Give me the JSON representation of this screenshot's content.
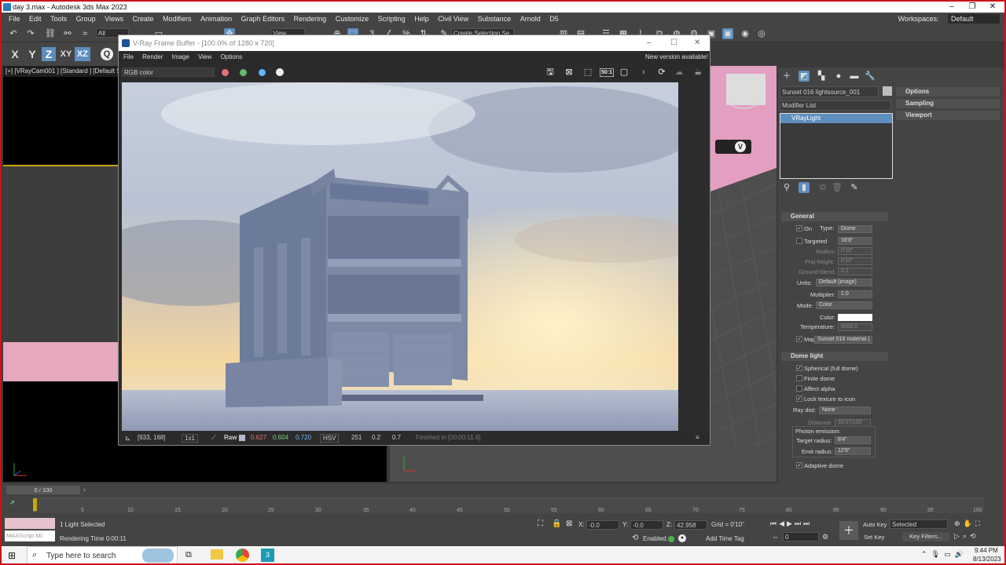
{
  "window": {
    "title": "day 3.max - Autodesk 3ds Max 2023"
  },
  "menu": [
    "File",
    "Edit",
    "Tools",
    "Group",
    "Views",
    "Create",
    "Modifiers",
    "Animation",
    "Graph Editors",
    "Rendering",
    "Customize",
    "Scripting",
    "Help",
    "Civil View",
    "Substance",
    "Arnold",
    "D5"
  ],
  "workspaces": {
    "label": "Workspaces:",
    "value": "Default"
  },
  "toolbar": {
    "filter": "All",
    "view": "View",
    "selection_set": "Create Selection Se"
  },
  "axes": {
    "x": "X",
    "y": "Y",
    "z": "Z",
    "xy": "XY",
    "xz": "XZ"
  },
  "viewport": {
    "label": "[+] [VRayCam001 ] [Standard ] [Default Sh"
  },
  "vfb": {
    "title": "V-Ray Frame Buffer - [100.0% of 1280 x 720]",
    "menu": [
      "File",
      "Render",
      "Image",
      "View",
      "Options"
    ],
    "new_version": "New version available!",
    "channel": "RGB color",
    "ratio": "50:1",
    "status": {
      "coords": "[933, 168]",
      "zoom": "1x1",
      "raw": "Raw",
      "r": "0.627",
      "g": "0.604",
      "b": "0.720",
      "mode": "HSV",
      "h": "251",
      "s": "0.2",
      "v": "0.7",
      "finished": "Finished in [00:00:11.6]"
    }
  },
  "command_panel": {
    "object_name": "Sunset 016 lightsource_001",
    "modifier_list": "Modifier List",
    "stack_item": "VRayLight",
    "rollouts_right": [
      "Options",
      "Sampling",
      "Viewport"
    ]
  },
  "general": {
    "title": "General",
    "on": "On",
    "type_label": "Type:",
    "type_value": "Dome",
    "targeted": "Targeted",
    "targeted_value": "16'8\"",
    "radius": "Radius:",
    "radius_value": "0'10\"",
    "proj_height": "Proj height:",
    "proj_value": "0'10\"",
    "ground_blend": "Ground blend:",
    "ground_value": "0.2",
    "units": "Units:",
    "units_value": "Default (image)",
    "multiplier": "Multiplier:",
    "multiplier_value": "1.0",
    "mode": "Mode:",
    "mode_value": "Color",
    "color": "Color:",
    "temperature": "Temperature:",
    "temperature_value": "6500.0",
    "map": "Map",
    "map_value": "Sunset 016 material  ("
  },
  "dome": {
    "title": "Dome light",
    "spherical": "Spherical (full dome)",
    "finite": "Finite dome",
    "affect_alpha": "Affect alpha",
    "lock": "Lock texture to icon",
    "ray_dist": "Ray dist:",
    "ray_value": "None",
    "distance": "Distance:",
    "distance_value": "33'37|100'",
    "photon": "Photon emission:",
    "target_radius": "Target radius:",
    "target_value": "8'4\"",
    "emit_radius": "Emit radius:",
    "emit_value": "12'6\"",
    "adaptive": "Adaptive dome"
  },
  "timeline": {
    "frame": "0 / 100",
    "ticks": [
      "0",
      "5",
      "10",
      "15",
      "20",
      "25",
      "30",
      "35",
      "40",
      "45",
      "50",
      "55",
      "60",
      "65",
      "70",
      "75",
      "80",
      "85",
      "90",
      "95",
      "100"
    ]
  },
  "status": {
    "maxscript": "MAXScript Mi:",
    "selected": "1 Light Selected",
    "render_time": "Rendering Time  0:00:11",
    "x_label": "X:",
    "x": "-0.0",
    "y_label": "Y:",
    "y": "-0.0",
    "z_label": "Z:",
    "z": "42.958",
    "grid": "Grid = 0'10\"",
    "enabled": "Enabled:",
    "add_time_tag": "Add Time Tag",
    "frame_value": "0",
    "auto_key": "Auto Key",
    "set_key": "Set Key",
    "selected_dd": "Selected",
    "key_filters": "Key Filters..."
  },
  "taskbar": {
    "search": "Type here to search",
    "time": "9:44 PM",
    "date": "8/13/2023"
  },
  "colors": {
    "accent": "#5d8ebd",
    "frame_border": "#c9141b",
    "pink": "#e8a0c8"
  }
}
